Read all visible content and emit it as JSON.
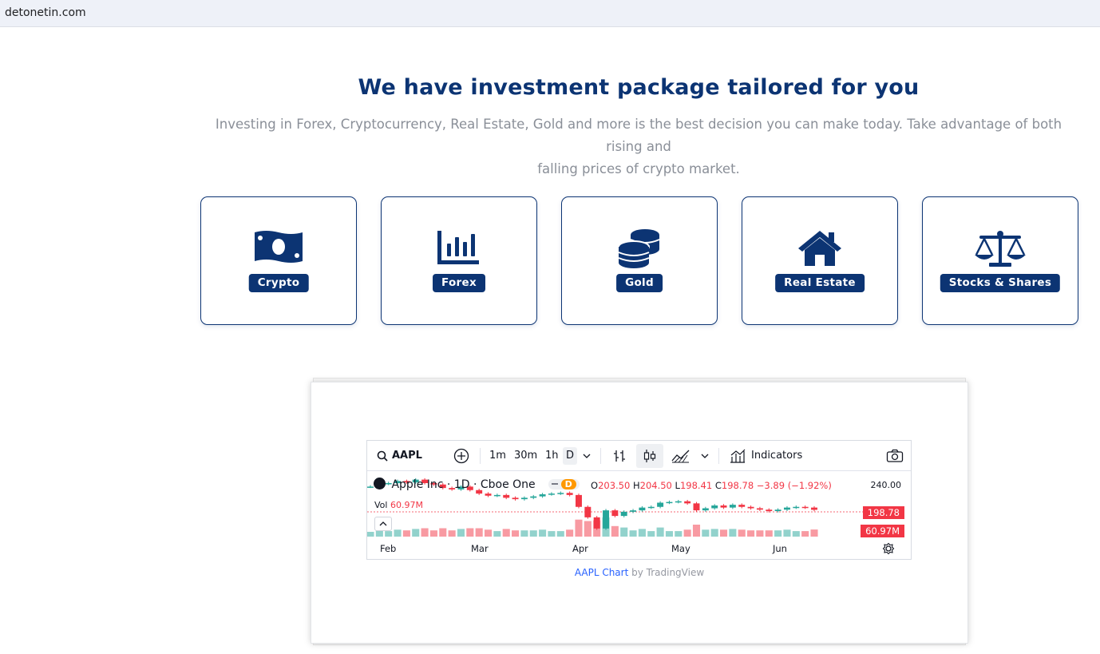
{
  "browser": {
    "url": "detonetin.com"
  },
  "hero": {
    "title": "We have investment package tailored for you",
    "subtitle_line1": "Investing in Forex, Cryptocurrency, Real Estate, Gold and more is the best decision you can make today. Take advantage of both rising and",
    "subtitle_line2": "falling prices of crypto market."
  },
  "packages": [
    {
      "label": "Crypto",
      "icon": "money-bill-icon"
    },
    {
      "label": "Forex",
      "icon": "bar-chart-icon"
    },
    {
      "label": "Gold",
      "icon": "coins-icon"
    },
    {
      "label": "Real Estate",
      "icon": "house-icon"
    },
    {
      "label": "Stocks & Shares",
      "icon": "balance-scale-icon"
    }
  ],
  "colors": {
    "brand": "#0c3473",
    "up": "#26a69a",
    "down": "#f23645",
    "muted": "#8a8f98"
  },
  "chart": {
    "symbol": "AAPL",
    "intervals": [
      "1m",
      "30m",
      "1h",
      "D"
    ],
    "selected_interval": "D",
    "indicators_label": "Indicators",
    "legend_title": "Apple Inc · 1D · Cboe One",
    "legend_badge": "D",
    "ohlc": {
      "o_label": "O",
      "o": "203.50",
      "h_label": "H",
      "h": "204.50",
      "l_label": "L",
      "l": "198.41",
      "c_label": "C",
      "c": "198.78",
      "change": "−3.89 (−1.92%)"
    },
    "vol_label": "Vol",
    "vol_value": "60.97M",
    "price_axis_top": "240.00",
    "last_price_tag": "198.78",
    "volume_tag": "60.97M",
    "x_labels": [
      "Feb",
      "Mar",
      "Apr",
      "May",
      "Jun"
    ]
  },
  "credit": {
    "link_text": "AAPL Chart",
    "suffix": " by TradingView"
  },
  "chart_data": {
    "type": "line",
    "title": "",
    "series": [
      {
        "values": [
          232,
          236,
          237,
          240,
          238,
          242,
          237,
          235,
          230,
          228,
          232,
          227,
          222,
          219,
          220,
          216,
          214,
          216,
          218,
          221,
          222,
          223,
          220,
          203,
          188,
          172,
          198,
          190,
          196,
          198,
          202,
          203,
          209,
          210,
          211,
          208,
          198,
          201,
          205,
          202,
          206,
          203,
          201,
          199,
          197,
          199,
          202,
          203,
          202,
          198.78
        ]
      }
    ],
    "x_ticks": [
      "Feb",
      "Mar",
      "Apr",
      "May",
      "Jun"
    ],
    "ylabel": "",
    "grid": false
  }
}
